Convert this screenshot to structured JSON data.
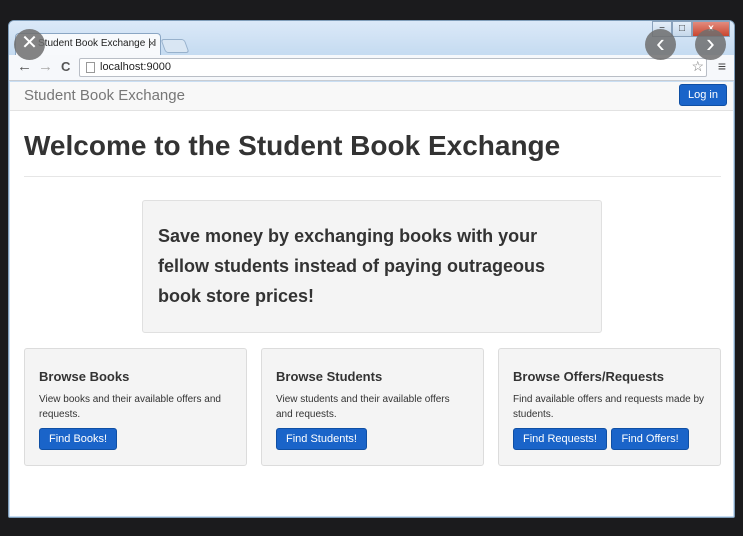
{
  "browser": {
    "tab_title": "Student Book Exchange | I",
    "tab_close": "×",
    "url": "localhost:9000",
    "window_buttons": {
      "minimize": "−",
      "maximize": "□",
      "close": "x"
    },
    "nav": {
      "back": "←",
      "forward": "→",
      "reload": "C"
    },
    "star": "☆",
    "menu": "≡"
  },
  "overlay": {
    "close": "✕",
    "prev": "‹",
    "next": "›"
  },
  "navbar": {
    "brand": "Student Book Exchange",
    "login": "Log in"
  },
  "main": {
    "title": "Welcome to the Student Book Exchange",
    "jumbotron": "Save money by exchanging books with your fellow students instead of paying outrageous book store prices!"
  },
  "cards": [
    {
      "title": "Browse Books",
      "text": "View books and their available offers and requests.",
      "buttons": [
        "Find Books!"
      ]
    },
    {
      "title": "Browse Students",
      "text": "View students and their available offers and requests.",
      "buttons": [
        "Find Students!"
      ]
    },
    {
      "title": "Browse Offers/Requests",
      "text": "Find available offers and requests made by students.",
      "buttons": [
        "Find Requests!",
        "Find Offers!"
      ]
    }
  ],
  "colors": {
    "primary": "#1a64c9",
    "chrome_frame": "#c9def3",
    "well_bg": "#f4f4f4"
  }
}
